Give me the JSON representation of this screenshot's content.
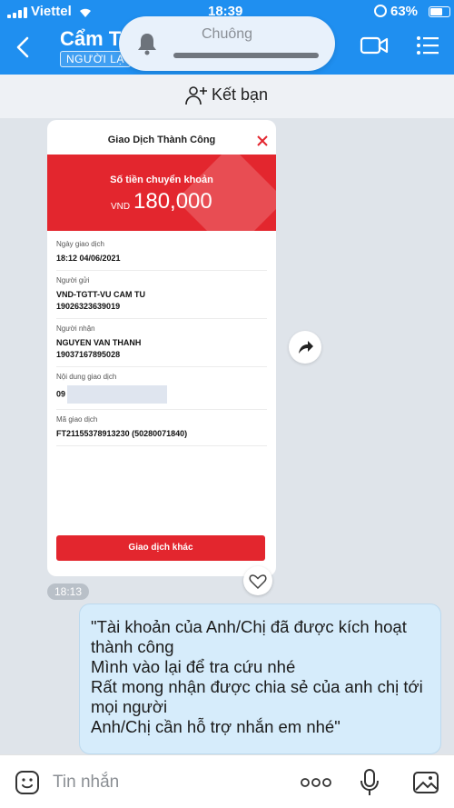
{
  "status_bar": {
    "carrier": "Viettel",
    "time": "18:39",
    "battery": "63%"
  },
  "header": {
    "contact_name": "Cẩm Tú",
    "stranger_badge": "NGƯỜI LẠ"
  },
  "notification_pill": {
    "label": "Chuông"
  },
  "friend_bar": {
    "label": "Kết bạn"
  },
  "receipt": {
    "title": "Giao Dịch Thành Công",
    "amount_label": "Số tiền chuyển khoản",
    "currency": "VND",
    "amount": "180,000",
    "fields": [
      {
        "label": "Ngày giao dịch",
        "value": "18:12 04/06/2021"
      },
      {
        "label": "Người gửi",
        "value": "VND-TGTT-VU CAM TU",
        "value2": "19026323639019"
      },
      {
        "label": "Người nhận",
        "value": "NGUYEN VAN THANH",
        "value2": "19037167895028"
      },
      {
        "label": "Nội dung giao dịch",
        "value": "09"
      },
      {
        "label": "Mã giao dịch",
        "value": "FT21155378913230 (50280071840)"
      }
    ],
    "button": "Giao dịch khác"
  },
  "time_chip": "18:13",
  "message": {
    "text": "\"Tài khoản của Anh/Chị đã được kích hoạt thành công\nMình vào lại để tra cứu nhé\nRất mong nhận được chia sẻ của anh chị tới mọi người\nAnh/Chị cần hỗ trợ nhắn em nhé\""
  },
  "input_bar": {
    "placeholder": "Tin nhắn"
  },
  "colors": {
    "header_blue": "#1f8ff0",
    "receipt_red": "#e3262e",
    "bubble_blue": "#d6ecfb"
  }
}
